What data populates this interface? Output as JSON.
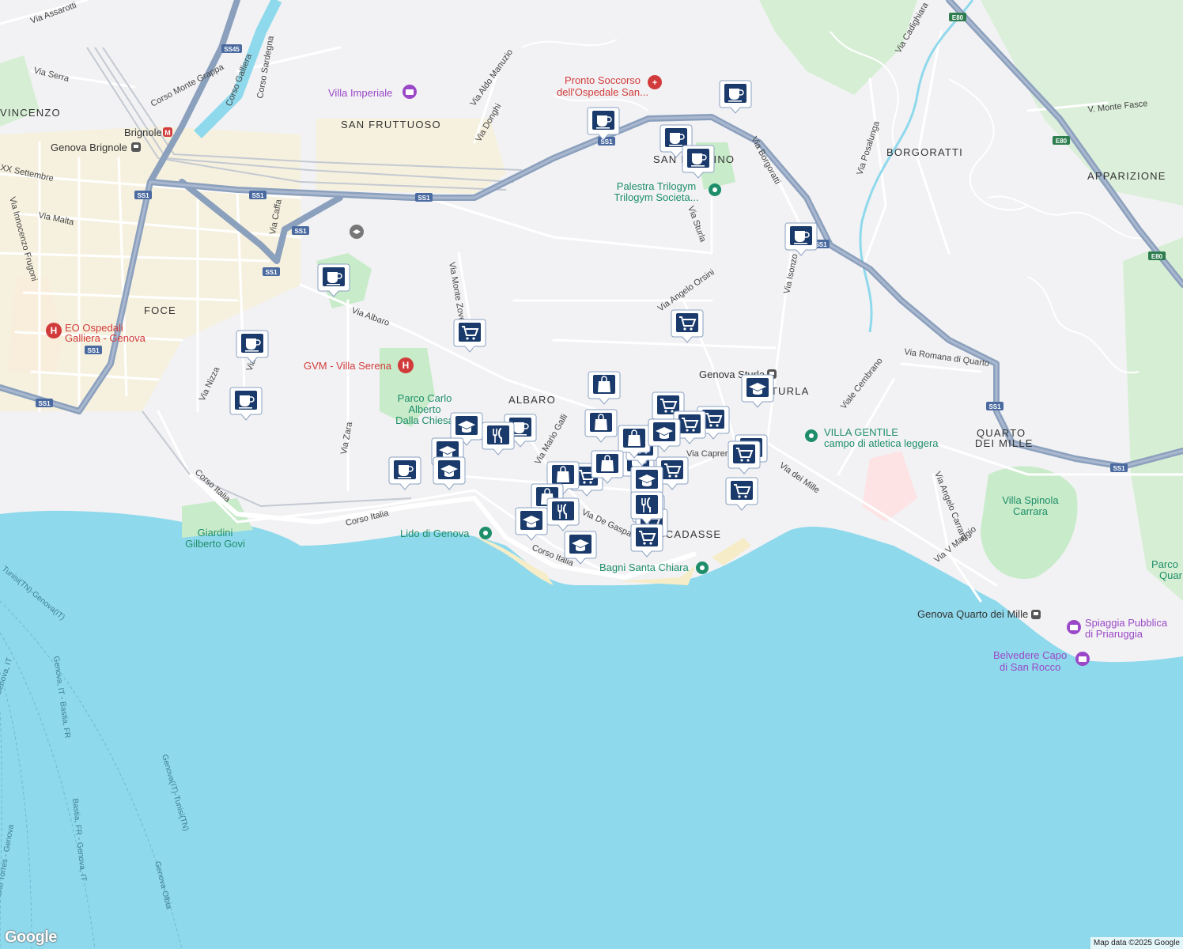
{
  "map": {
    "attribution": "Map data ©2025 Google",
    "logo": "Google",
    "colors": {
      "sea": "#8fd9ec",
      "land": "#f2f2f4",
      "highway": "#8ba0bd",
      "park": "#c8ebc9",
      "beach": "#f6ecc7",
      "road": "#ffffff",
      "marker": "#1a3a6b"
    },
    "areas": [
      "SAN FRUTTUOSO",
      "BORGORATTI",
      "APPARIZIONE",
      "FOCE",
      "ALBARO",
      "QUARTO",
      "DEI MILLE",
      "STURLA",
      "BOCCADASSE",
      "SAN MARTINO",
      "VINCENZO"
    ],
    "streets": [
      "Via Serra",
      "Via Assarotti",
      "Corso Monte Grappa",
      "Corso Galliera",
      "Corso Sardegna",
      "Via Aldo Manuzio",
      "Via Donghi",
      "Via Borgoratti",
      "Via Cadighiara",
      "V. Monte Fasce",
      "Via Posalunga",
      "Via Isonzo",
      "Via Sturla",
      "Via Angelo Orsini",
      "Via Albaro",
      "Via Caffa",
      "Via Malta",
      "XX Settembre",
      "Via Innocenzo Frugoni",
      "Via Nizza",
      "Via Trento",
      "Via Monte Zovetto",
      "Via Zara",
      "Corso Italia",
      "Via Mario Galli",
      "Via De Gaspari",
      "Via Caprera",
      "Via dei Mille",
      "Via Romana di Quarto",
      "Viale Cembrano",
      "Via Angelo Carrara",
      "Via V Maggio"
    ],
    "pois": [
      "Villa Imperiale",
      "Pronto Soccorso dell'Ospedale San...",
      "Palestra Trilogym",
      "Trilogym Societa...",
      "EO Ospedali",
      "Galliera - Genova",
      "GVM - Villa Serena",
      "Parco Carlo",
      "Alberto",
      "Dalla Chiesa",
      "Genova Sturla",
      "VILLA GENTILE",
      "campo di atletica leggera",
      "Villa Spinola",
      "Carrara",
      "Lido di Genova",
      "Bagni Santa Chiara",
      "Giardini",
      "Gilberto Govi",
      "Genova Quarto dei Mille",
      "Spiaggia Pubblica",
      "di Priaruggia",
      "Belvedere Capo",
      "di San Rocco",
      "Brignole",
      "Genova Brignole",
      "Parco",
      "Quar"
    ],
    "ferries": [
      "Genova(IT)-Tunisi(TN)",
      "Genova, IT - Bastia, FR",
      "Bastia, FR - Genova, IT",
      "Genova-Olbia",
      "Tunisi(TN)-Genova(IT)",
      "Porto Torres - Genova",
      "Genova, IT"
    ],
    "road_shields": [
      "SS1",
      "SS45",
      "E80"
    ],
    "marker_types": [
      "coffee-icon",
      "cart-icon",
      "shopping-bag-icon",
      "school-icon",
      "restaurant-icon"
    ]
  }
}
